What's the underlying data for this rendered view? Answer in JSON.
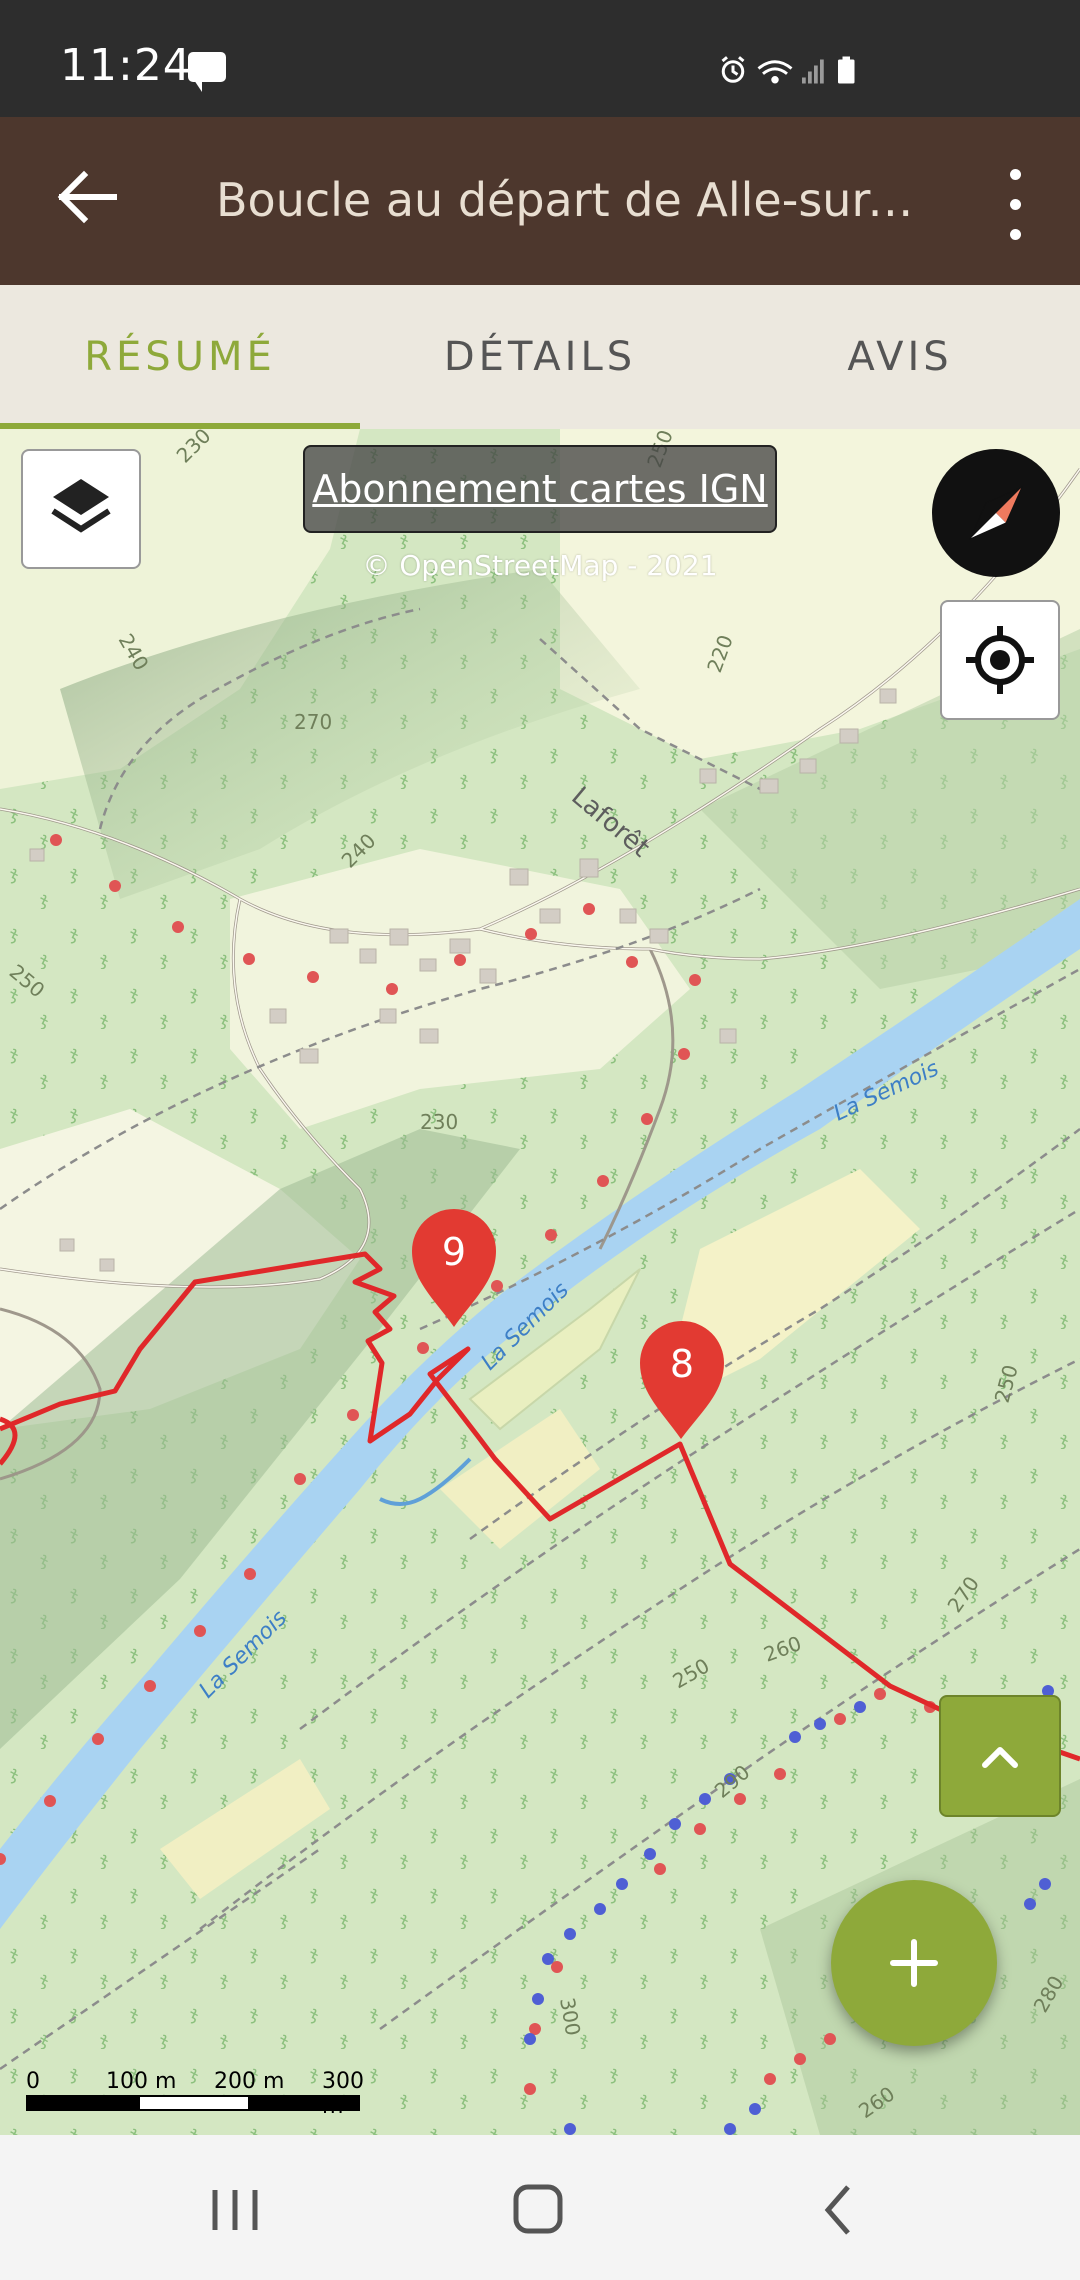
{
  "status_bar": {
    "time": "11:24",
    "icons": [
      "message-icon",
      "alarm-icon",
      "wifi-icon",
      "signal-icon",
      "battery-icon"
    ]
  },
  "header": {
    "title": "Boucle au départ de Alle-sur-S..."
  },
  "tabs": [
    {
      "label": "RÉSUMÉ",
      "active": true
    },
    {
      "label": "DÉTAILS",
      "active": false
    },
    {
      "label": "AVIS",
      "active": false
    }
  ],
  "map": {
    "ign_banner": "Abonnement cartes IGN",
    "attribution": "© OpenStreetMap - 2021",
    "labels": {
      "village": "Laforêt",
      "river_1": "La Semois",
      "river_2": "La Semois",
      "river_3": "La Semois",
      "c230a": "230",
      "c270": "270",
      "c240a": "240",
      "c250a": "250",
      "c230b": "230",
      "c240b": "240",
      "c250b": "250",
      "c260a": "260",
      "c250c": "250",
      "c270b": "270",
      "c280": "280",
      "c290": "290",
      "c300": "300",
      "c260b": "260",
      "c220": "220",
      "c250d": "250"
    },
    "markers": [
      {
        "label": "9",
        "color": "#e23a32"
      },
      {
        "label": "8",
        "color": "#e23a32"
      }
    ],
    "route_color": "#e0282a",
    "scale": {
      "labels": [
        "0",
        "100 m",
        "200 m",
        "300 m"
      ]
    }
  },
  "colors": {
    "accent": "#8ea93a",
    "header": "#4d372d",
    "tabs_bg": "#ece8df",
    "water": "#a9d3f2"
  }
}
